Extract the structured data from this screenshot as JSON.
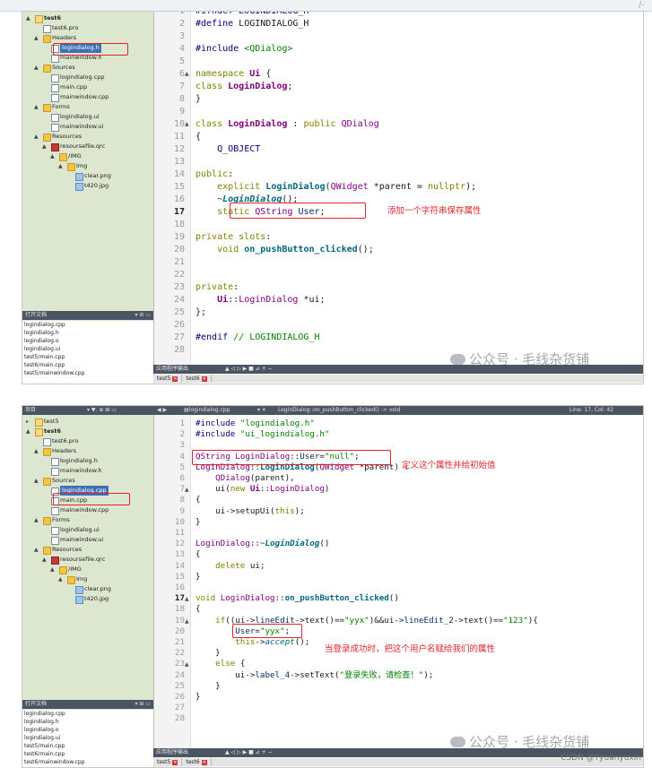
{
  "top_corner": "/-",
  "watermark": "公众号 · 毛线杂货铺",
  "credit": "CSDN @Yyuanyuxin",
  "shot1": {
    "tree": [
      {
        "label": "test6",
        "level": 0,
        "kind": "proj",
        "arrow": "▲",
        "bold": true
      },
      {
        "label": "test6.pro",
        "level": 1,
        "kind": "file"
      },
      {
        "label": "Headers",
        "level": 1,
        "kind": "folder",
        "arrow": "▲"
      },
      {
        "label": "logindialog.h",
        "level": 2,
        "kind": "file",
        "sel": true
      },
      {
        "label": "mainwindow.h",
        "level": 2,
        "kind": "file"
      },
      {
        "label": "Sources",
        "level": 1,
        "kind": "folder",
        "arrow": "▲"
      },
      {
        "label": "logindialog.cpp",
        "level": 2,
        "kind": "file"
      },
      {
        "label": "main.cpp",
        "level": 2,
        "kind": "file"
      },
      {
        "label": "mainwindow.cpp",
        "level": 2,
        "kind": "file"
      },
      {
        "label": "Forms",
        "level": 1,
        "kind": "folder",
        "arrow": "▲"
      },
      {
        "label": "logindialog.ui",
        "level": 2,
        "kind": "file"
      },
      {
        "label": "mainwindow.ui",
        "level": 2,
        "kind": "file"
      },
      {
        "label": "Resources",
        "level": 1,
        "kind": "folder",
        "arrow": "▲"
      },
      {
        "label": "resoursefile.qrc",
        "level": 2,
        "kind": "qrc",
        "arrow": "▲"
      },
      {
        "label": "/IMG",
        "level": 3,
        "kind": "folder",
        "arrow": "▲"
      },
      {
        "label": "Img",
        "level": 4,
        "kind": "folder",
        "arrow": "▲"
      },
      {
        "label": "clear.png",
        "level": 5,
        "kind": "img"
      },
      {
        "label": "t420.jpg",
        "level": 5,
        "kind": "img"
      }
    ],
    "open_docs_header": "打开文档",
    "open_docs_controls": "▾ ⊞ ▭",
    "open_docs": [
      "logindialog.cpp",
      "logindialog.h",
      "logindialog.o",
      "logindialog.ui",
      "test5/main.cpp",
      "test6/main.cpp",
      "test5/mainwindow.cpp"
    ],
    "bottom_header": "应用程序输出",
    "bottom_controls": "▲ ◁ ▷ ▶ ■ ⊿ + −",
    "bottom_tabs": [
      "test5",
      "test6"
    ],
    "line_numbers": [
      1,
      2,
      3,
      4,
      5,
      6,
      7,
      8,
      9,
      10,
      11,
      12,
      13,
      14,
      15,
      16,
      17,
      18,
      19,
      20,
      21,
      22,
      23,
      24,
      25,
      26,
      27,
      28
    ],
    "current_line": 17,
    "fold_lines": [
      6,
      10
    ],
    "annotation": "添加一个字符串保存属性"
  },
  "shot2": {
    "topbar": {
      "project_label": "项目",
      "filter_controls": "▾ ▼. ⊕ ⊞ ▭",
      "nav": "◀ ▶",
      "file": "logindialog.cpp",
      "close": "▾  ✕",
      "symbol": "LoginDialog::on_pushButton_clicked() -> void",
      "position": "Line: 17, Col: 42"
    },
    "tree": [
      {
        "label": "test5",
        "level": 0,
        "kind": "proj",
        "arrow": "▸"
      },
      {
        "label": "test6",
        "level": 0,
        "kind": "proj",
        "arrow": "▲",
        "bold": true
      },
      {
        "label": "test6.pro",
        "level": 1,
        "kind": "file"
      },
      {
        "label": "Headers",
        "level": 1,
        "kind": "folder",
        "arrow": "▲"
      },
      {
        "label": "logindialog.h",
        "level": 2,
        "kind": "file"
      },
      {
        "label": "mainwindow.h",
        "level": 2,
        "kind": "file"
      },
      {
        "label": "Sources",
        "level": 1,
        "kind": "folder",
        "arrow": "▲"
      },
      {
        "label": "logindialog.cpp",
        "level": 2,
        "kind": "file",
        "sel": true
      },
      {
        "label": "main.cpp",
        "level": 2,
        "kind": "file"
      },
      {
        "label": "mainwindow.cpp",
        "level": 2,
        "kind": "file"
      },
      {
        "label": "Forms",
        "level": 1,
        "kind": "folder",
        "arrow": "▲"
      },
      {
        "label": "logindialog.ui",
        "level": 2,
        "kind": "file"
      },
      {
        "label": "mainwindow.ui",
        "level": 2,
        "kind": "file"
      },
      {
        "label": "Resources",
        "level": 1,
        "kind": "folder",
        "arrow": "▲"
      },
      {
        "label": "resoursefile.qrc",
        "level": 2,
        "kind": "qrc",
        "arrow": "▲"
      },
      {
        "label": "/IMG",
        "level": 3,
        "kind": "folder",
        "arrow": "▲"
      },
      {
        "label": "Img",
        "level": 4,
        "kind": "folder",
        "arrow": "▲"
      },
      {
        "label": "clear.png",
        "level": 5,
        "kind": "img"
      },
      {
        "label": "t420.jpg",
        "level": 5,
        "kind": "img"
      }
    ],
    "open_docs_header": "打开文档",
    "open_docs_controls": "▾ ⊞ ▭",
    "open_docs": [
      "logindialog.cpp",
      "logindialog.h",
      "logindialog.o",
      "logindialog.ui",
      "test5/main.cpp",
      "test6/main.cpp",
      "test6/mainwindow.cpp"
    ],
    "bottom_header": "应用程序输出",
    "bottom_controls": "▲ ◁ ▷ ▶ ■ ⊿ + −",
    "bottom_tabs": [
      "test5",
      "test6"
    ],
    "line_numbers": [
      1,
      2,
      3,
      4,
      5,
      6,
      7,
      8,
      9,
      10,
      11,
      12,
      13,
      14,
      15,
      16,
      17,
      18,
      19,
      20,
      21,
      22,
      23,
      24,
      25,
      26,
      27,
      28
    ],
    "current_line": 17,
    "fold_lines": [
      7,
      17,
      19,
      23
    ],
    "annotation_1": "定义这个属性并给初始值",
    "annotation_2": "当登录成功时，把这个用户名赋给我们的属性"
  },
  "colors": {
    "highlight": "#e0242c",
    "sidebar": "#dde7cf",
    "pane_header": "#4b5562",
    "selection": "#3f70b3"
  }
}
